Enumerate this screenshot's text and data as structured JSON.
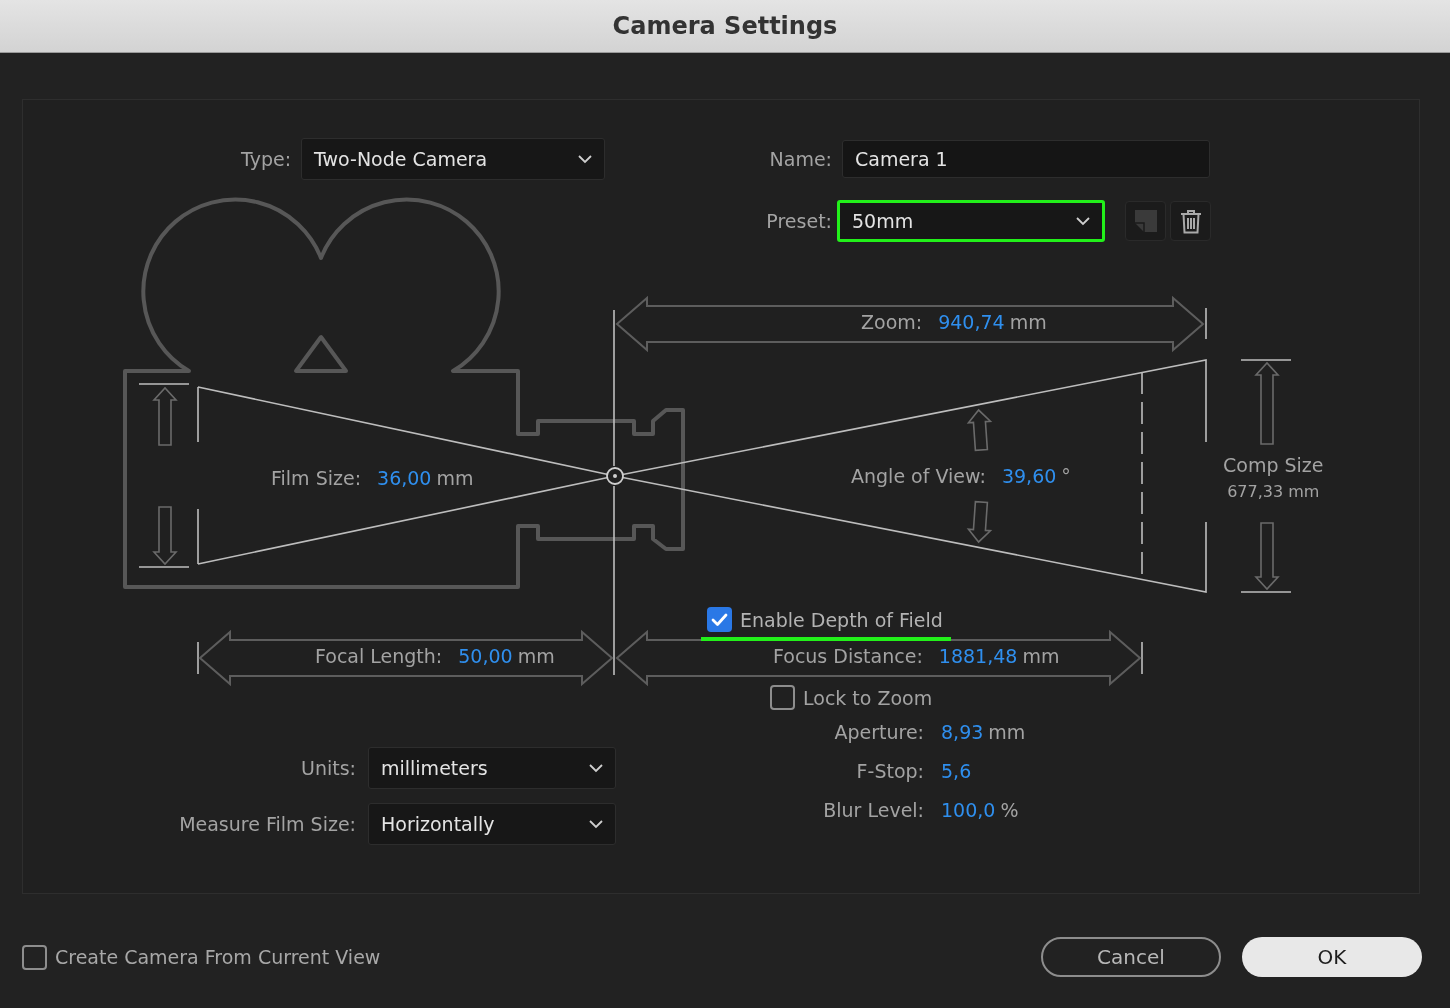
{
  "title": "Camera Settings",
  "type": {
    "label": "Type:",
    "value": "Two-Node Camera"
  },
  "name": {
    "label": "Name:",
    "value": "Camera 1"
  },
  "preset": {
    "label": "Preset:",
    "value": "50mm",
    "highlighted": true
  },
  "preset_actions": [
    {
      "kind": "page",
      "disabled": true
    },
    {
      "kind": "trash",
      "disabled": false
    }
  ],
  "measurements": [
    {
      "label": "Zoom:",
      "value": "940,74",
      "unit": "mm"
    },
    {
      "label": "Film Size:",
      "value": "36,00",
      "unit": "mm"
    },
    {
      "label": "Angle of View:",
      "value": "39,60",
      "unit": "°"
    },
    {
      "label": "Focal Length:",
      "value": "50,00",
      "unit": "mm"
    },
    {
      "label": "Focus Distance:",
      "value": "1881,48",
      "unit": "mm"
    }
  ],
  "comp_size": {
    "label": "Comp Size",
    "value": "677,33 mm"
  },
  "depth_of_field": {
    "label": "Enable Depth of Field",
    "checked": true,
    "highlighted": true
  },
  "lock_to_zoom": {
    "label": "Lock to Zoom",
    "checked": false
  },
  "dof_settings": [
    {
      "label": "Aperture:",
      "value": "8,93",
      "unit": "mm"
    },
    {
      "label": "F-Stop:",
      "value": "5,6"
    },
    {
      "label": "Blur Level:",
      "value": "100,0",
      "unit": "%"
    }
  ],
  "units": {
    "label": "Units:",
    "value": "millimeters"
  },
  "measure_film_size": {
    "label": "Measure Film Size:",
    "value": "Horizontally"
  },
  "create_from_view": {
    "label": "Create Camera From Current View",
    "checked": false
  },
  "buttons": [
    {
      "label": "Cancel",
      "kind": "secondary"
    },
    {
      "label": "OK",
      "kind": "primary"
    }
  ]
}
